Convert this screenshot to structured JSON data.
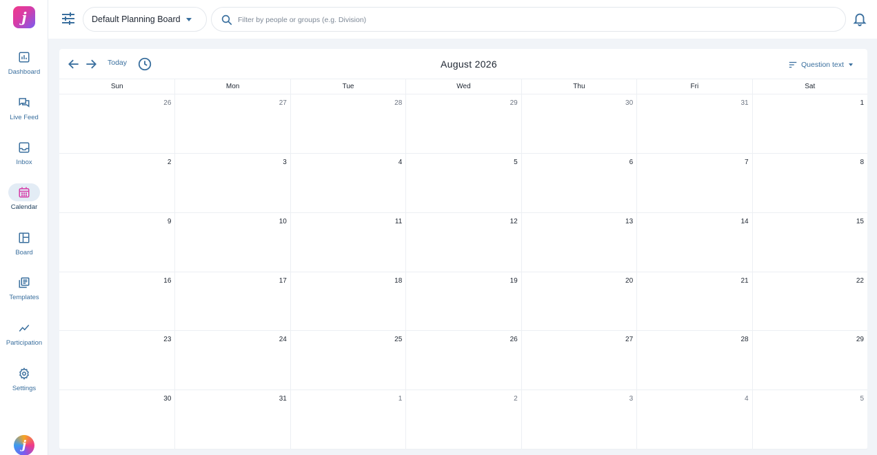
{
  "brand": {
    "logo_glyph": "j",
    "accent": "#3a6f9e",
    "gradient": [
      "#f03a8a",
      "#7a5cf0"
    ]
  },
  "sidebar": {
    "items": [
      {
        "id": "dashboard",
        "label": "Dashboard",
        "icon": "bar-chart-icon",
        "active": false
      },
      {
        "id": "live-feed",
        "label": "Live Feed",
        "icon": "chat-bubbles-icon",
        "active": false
      },
      {
        "id": "inbox",
        "label": "Inbox",
        "icon": "inbox-tray-icon",
        "active": false
      },
      {
        "id": "calendar",
        "label": "Calendar",
        "icon": "calendar-icon",
        "active": true
      },
      {
        "id": "board",
        "label": "Board",
        "icon": "board-layout-icon",
        "active": false
      },
      {
        "id": "templates",
        "label": "Templates",
        "icon": "templates-icon",
        "active": false
      },
      {
        "id": "participation",
        "label": "Participation",
        "icon": "trend-line-icon",
        "active": false
      },
      {
        "id": "settings",
        "label": "Settings",
        "icon": "gear-icon",
        "active": false
      }
    ]
  },
  "topbar": {
    "board_select": {
      "value": "Default Planning Board"
    },
    "search": {
      "placeholder": "Filter by people or groups (e.g. Division)",
      "value": ""
    }
  },
  "calendar": {
    "today_label": "Today",
    "month_title": "August 2026",
    "sort_label": "Question text",
    "weekdays": [
      "Sun",
      "Mon",
      "Tue",
      "Wed",
      "Thu",
      "Fri",
      "Sat"
    ],
    "weeks": [
      [
        {
          "d": "26",
          "other": true
        },
        {
          "d": "27",
          "other": true
        },
        {
          "d": "28",
          "other": true
        },
        {
          "d": "29",
          "other": true
        },
        {
          "d": "30",
          "other": true
        },
        {
          "d": "31",
          "other": true
        },
        {
          "d": "1",
          "other": false
        }
      ],
      [
        {
          "d": "2",
          "other": false
        },
        {
          "d": "3",
          "other": false
        },
        {
          "d": "4",
          "other": false
        },
        {
          "d": "5",
          "other": false
        },
        {
          "d": "6",
          "other": false
        },
        {
          "d": "7",
          "other": false
        },
        {
          "d": "8",
          "other": false
        }
      ],
      [
        {
          "d": "9",
          "other": false
        },
        {
          "d": "10",
          "other": false
        },
        {
          "d": "11",
          "other": false
        },
        {
          "d": "12",
          "other": false
        },
        {
          "d": "13",
          "other": false
        },
        {
          "d": "14",
          "other": false
        },
        {
          "d": "15",
          "other": false
        }
      ],
      [
        {
          "d": "16",
          "other": false
        },
        {
          "d": "17",
          "other": false
        },
        {
          "d": "18",
          "other": false
        },
        {
          "d": "19",
          "other": false
        },
        {
          "d": "20",
          "other": false
        },
        {
          "d": "21",
          "other": false
        },
        {
          "d": "22",
          "other": false
        }
      ],
      [
        {
          "d": "23",
          "other": false
        },
        {
          "d": "24",
          "other": false
        },
        {
          "d": "25",
          "other": false
        },
        {
          "d": "26",
          "other": false
        },
        {
          "d": "27",
          "other": false
        },
        {
          "d": "28",
          "other": false
        },
        {
          "d": "29",
          "other": false
        }
      ],
      [
        {
          "d": "30",
          "other": false
        },
        {
          "d": "31",
          "other": false
        },
        {
          "d": "1",
          "other": true
        },
        {
          "d": "2",
          "other": true
        },
        {
          "d": "3",
          "other": true
        },
        {
          "d": "4",
          "other": true
        },
        {
          "d": "5",
          "other": true
        }
      ]
    ]
  }
}
